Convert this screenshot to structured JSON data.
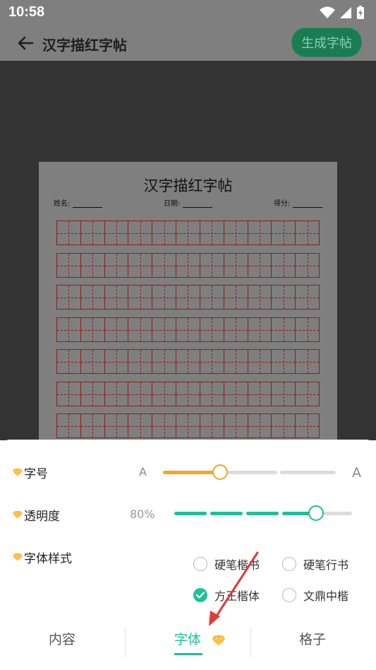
{
  "status_bar": {
    "time": "10:58"
  },
  "app_bar": {
    "title": "汉字描红字帖",
    "generate_button": "生成字帖"
  },
  "sheet": {
    "title": "汉字描红字帖",
    "name_label": "姓名:",
    "date_label": "日期:",
    "score_label": "得分:"
  },
  "settings": {
    "font_size": {
      "label": "字号",
      "small_a": "A",
      "large_a": "A",
      "value_fraction": 0.33
    },
    "opacity": {
      "label": "透明度",
      "value": "80%",
      "value_fraction": 0.8
    },
    "font_style": {
      "label": "字体样式",
      "options": [
        {
          "label": "硬笔楷书",
          "selected": false
        },
        {
          "label": "硬笔行书",
          "selected": false
        },
        {
          "label": "方正楷体",
          "selected": true
        },
        {
          "label": "文鼎中楷",
          "selected": false
        }
      ]
    }
  },
  "tabs": [
    {
      "label": "内容",
      "active": false
    },
    {
      "label": "字体",
      "active": true
    },
    {
      "label": "格子",
      "active": false
    }
  ],
  "colors": {
    "accent": "#1ec09a",
    "slider_orange": "#f5a623",
    "gem": "#f7b731",
    "arrow": "#e03a3a",
    "grid_red": "#8a2020"
  }
}
